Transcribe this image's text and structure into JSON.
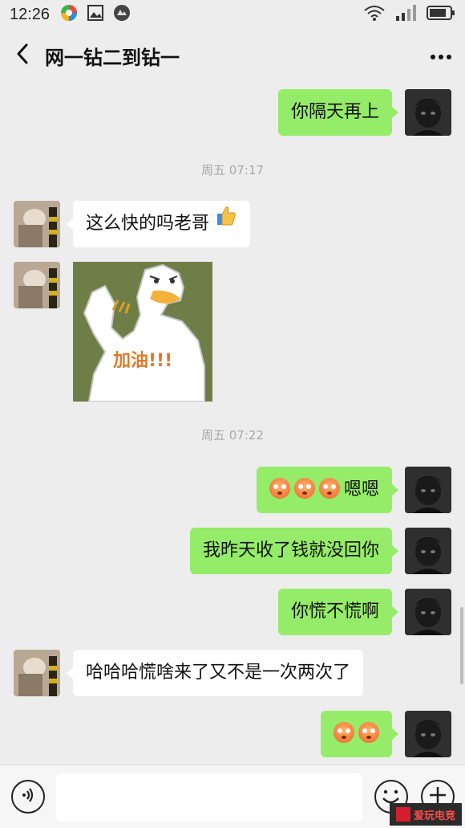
{
  "status_bar": {
    "time": "12:26",
    "icons": [
      "app-icon",
      "gallery-icon",
      "app-icon-2",
      "wifi-icon",
      "signal-icon",
      "battery-icon"
    ]
  },
  "header": {
    "title": "网一钻二到钻一",
    "back_icon": "chevron-left-icon",
    "more_icon": "more-dots-icon"
  },
  "messages": [
    {
      "side": "me",
      "text": "你隔天再上"
    },
    {
      "type": "timestamp",
      "text": "周五 07:17"
    },
    {
      "side": "other",
      "text": "这么快的吗老哥",
      "emoji": "thumbs-up"
    },
    {
      "side": "other",
      "type": "sticker",
      "sticker_text": "加油!!!"
    },
    {
      "type": "timestamp",
      "text": "周五 07:22"
    },
    {
      "side": "me",
      "text": "嗯嗯",
      "emoji_prefix_count": 3
    },
    {
      "side": "me",
      "text": "我昨天收了钱就没回你"
    },
    {
      "side": "me",
      "text": "你慌不慌啊"
    },
    {
      "side": "other",
      "text": "哈哈哈慌啥来了又不是一次两次了"
    },
    {
      "side": "me",
      "text": "",
      "emoji_prefix_count": 2
    }
  ],
  "input_bar": {
    "voice_icon": "voice-icon",
    "input_value": "",
    "emoji_icon": "emoji-icon",
    "plus_icon": "plus-icon"
  },
  "watermark": {
    "text": "爱玩电竞"
  },
  "colors": {
    "background": "#ededed",
    "my_bubble": "#95ec69",
    "other_bubble": "#ffffff",
    "timestamp": "#a8a8a8"
  }
}
